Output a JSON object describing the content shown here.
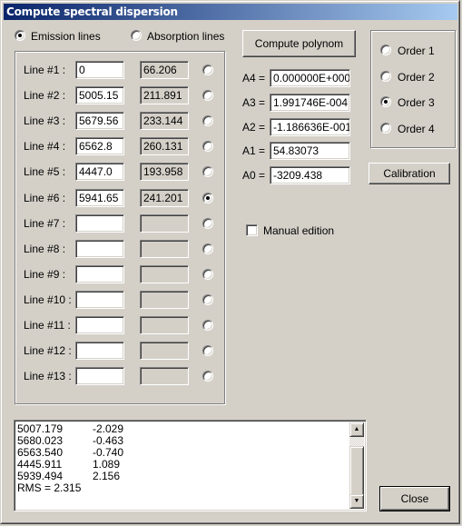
{
  "window": {
    "title": "Compute spectral dispersion"
  },
  "mode": {
    "options": [
      {
        "label": "Emission lines",
        "checked": true
      },
      {
        "label": "Absorption lines",
        "checked": false
      }
    ]
  },
  "lines": [
    {
      "label": "Line #1 :",
      "wavelength": "0",
      "position": "66.206",
      "selected": false
    },
    {
      "label": "Line #2 :",
      "wavelength": "5005.15",
      "position": "211.891",
      "selected": false
    },
    {
      "label": "Line #3 :",
      "wavelength": "5679.56",
      "position": "233.144",
      "selected": false
    },
    {
      "label": "Line #4 :",
      "wavelength": "6562.8",
      "position": "260.131",
      "selected": false
    },
    {
      "label": "Line #5 :",
      "wavelength": "4447.0",
      "position": "193.958",
      "selected": false
    },
    {
      "label": "Line #6 :",
      "wavelength": "5941.65",
      "position": "241.201",
      "selected": true
    },
    {
      "label": "Line #7 :",
      "wavelength": "",
      "position": "",
      "selected": false
    },
    {
      "label": "Line #8 :",
      "wavelength": "",
      "position": "",
      "selected": false
    },
    {
      "label": "Line #9 :",
      "wavelength": "",
      "position": "",
      "selected": false
    },
    {
      "label": "Line #10 :",
      "wavelength": "",
      "position": "",
      "selected": false
    },
    {
      "label": "Line #11 :",
      "wavelength": "",
      "position": "",
      "selected": false
    },
    {
      "label": "Line #12 :",
      "wavelength": "",
      "position": "",
      "selected": false
    },
    {
      "label": "Line #13 :",
      "wavelength": "",
      "position": "",
      "selected": false
    }
  ],
  "polynom": {
    "compute_label": "Compute polynom",
    "coefficients": [
      {
        "label": "A4 =",
        "value": "0.000000E+000"
      },
      {
        "label": "A3 =",
        "value": "1.991746E-004"
      },
      {
        "label": "A2 =",
        "value": "-1.186636E-001"
      },
      {
        "label": "A1 =",
        "value": "54.83073"
      },
      {
        "label": "A0 =",
        "value": "-3209.438"
      }
    ]
  },
  "order": {
    "options": [
      {
        "label": "Order 1",
        "checked": false
      },
      {
        "label": "Order 2",
        "checked": false
      },
      {
        "label": "Order 3",
        "checked": true
      },
      {
        "label": "Order 4",
        "checked": false
      }
    ]
  },
  "calibration_label": "Calibration",
  "manual_edition": {
    "label": "Manual edition",
    "checked": false
  },
  "output": {
    "rows": [
      {
        "c1": "5007.179",
        "c2": "-2.029"
      },
      {
        "c1": "5680.023",
        "c2": "-0.463"
      },
      {
        "c1": "6563.540",
        "c2": "-0.740"
      },
      {
        "c1": "4445.911",
        "c2": "1.089"
      },
      {
        "c1": "5939.494",
        "c2": "2.156"
      }
    ],
    "rms": "RMS = 2.315"
  },
  "close_label": "Close"
}
